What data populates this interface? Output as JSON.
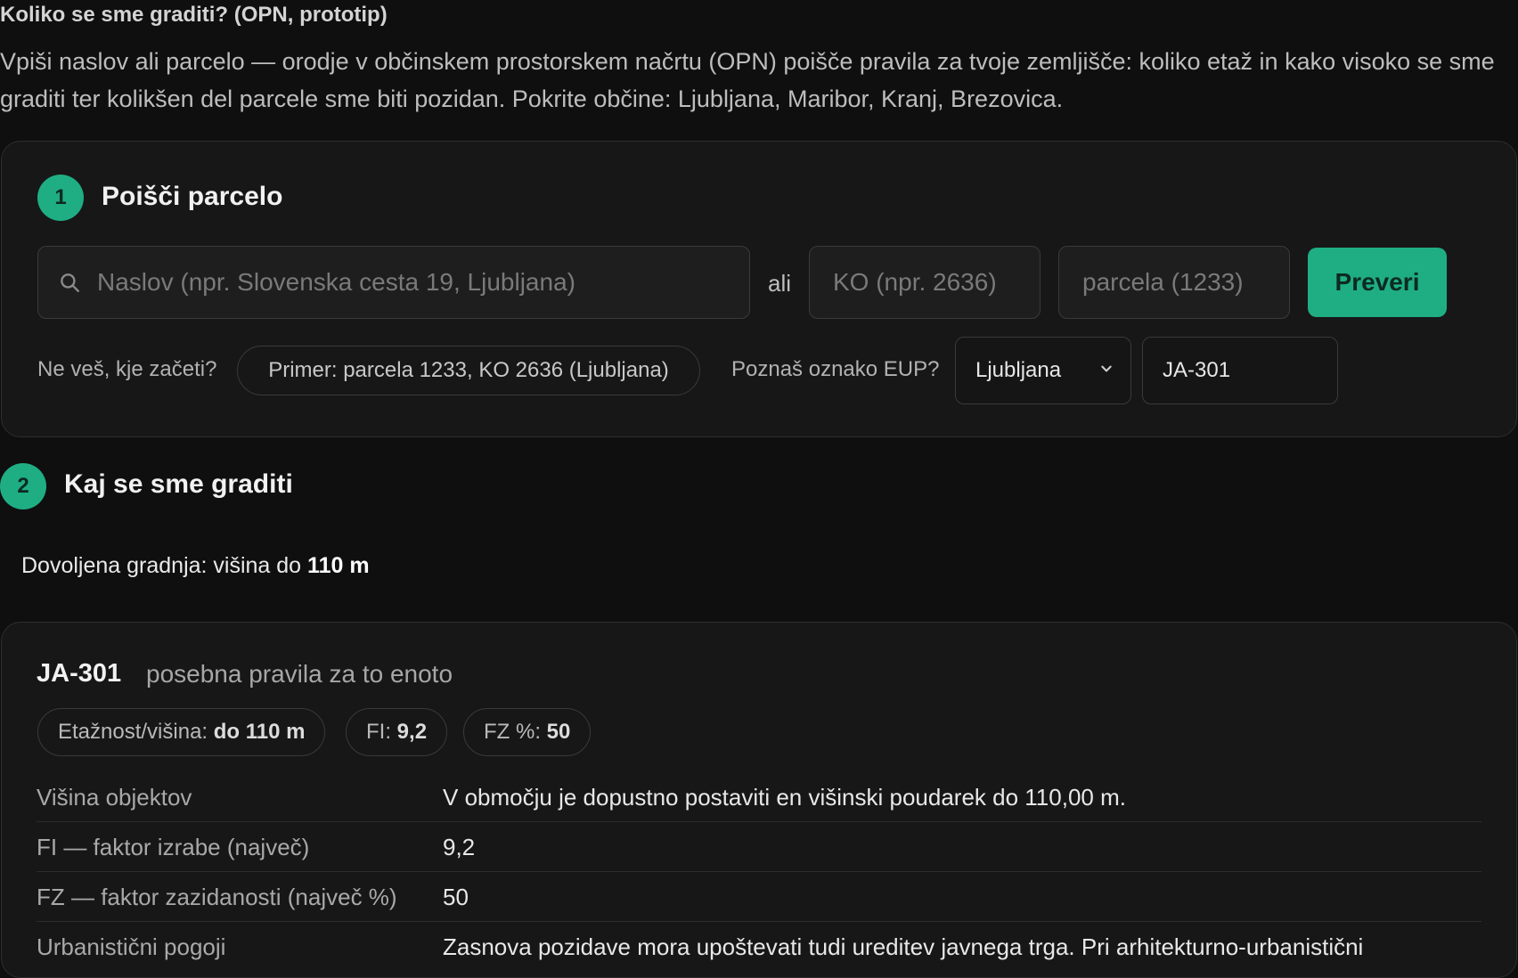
{
  "header": {
    "title": "Koliko se sme graditi? (OPN, prototip)",
    "intro": "Vpiši naslov ali parcelo — orodje v občinskem prostorskem načrtu (OPN) poišče pravila za tvoje zemljišče: koliko etaž in kako visoko se sme graditi ter kolikšen del parcele sme biti pozidan. Pokrite občine: Ljubljana, Maribor, Kranj, Brezovica."
  },
  "step1": {
    "number": "1",
    "title": "Poišči parcelo",
    "address_placeholder": "Naslov (npr. Slovenska cesta 19, Ljubljana)",
    "address_value": "",
    "or_label": "ali",
    "ko_placeholder": "KO (npr. 2636)",
    "ko_value": "",
    "parcel_placeholder": "parcela (1233)",
    "parcel_value": "",
    "check_button": "Preveri",
    "hint_label": "Ne veš, kje začeti?",
    "example_label": "Primer: parcela 1233, KO 2636 (Ljubljana)",
    "eup_question": "Poznaš oznako EUP?",
    "municipality_selected": "Ljubljana",
    "eup_value": "JA-301"
  },
  "step2": {
    "number": "2",
    "title": "Kaj se sme graditi",
    "allowed_prefix": "Dovoljena gradnja: višina do",
    "allowed_value": "110 m"
  },
  "eup_card": {
    "code": "JA-301",
    "subtitle": "posebna pravila za to enoto",
    "badges": [
      {
        "label": "Etažnost/višina:",
        "value": "do 110 m"
      },
      {
        "label": "FI:",
        "value": "9,2"
      },
      {
        "label": "FZ %:",
        "value": "50"
      }
    ],
    "rules": [
      {
        "label": "Višina objektov",
        "value": "V območju je dopustno postaviti en višinski poudarek do 110,00 m."
      },
      {
        "label": "FI — faktor izrabe (največ)",
        "value": "9,2"
      },
      {
        "label": "FZ — faktor zazidanosti (največ %)",
        "value": "50"
      },
      {
        "label": "Urbanistični pogoji",
        "value": "Zasnova pozidave mora upoštevati tudi ureditev javnega trga. Pri arhitekturno-urbanistični"
      }
    ]
  },
  "colors": {
    "accent": "#1fae84",
    "background": "#0f0f0f",
    "card": "#171717",
    "border": "#2d2d2d"
  }
}
